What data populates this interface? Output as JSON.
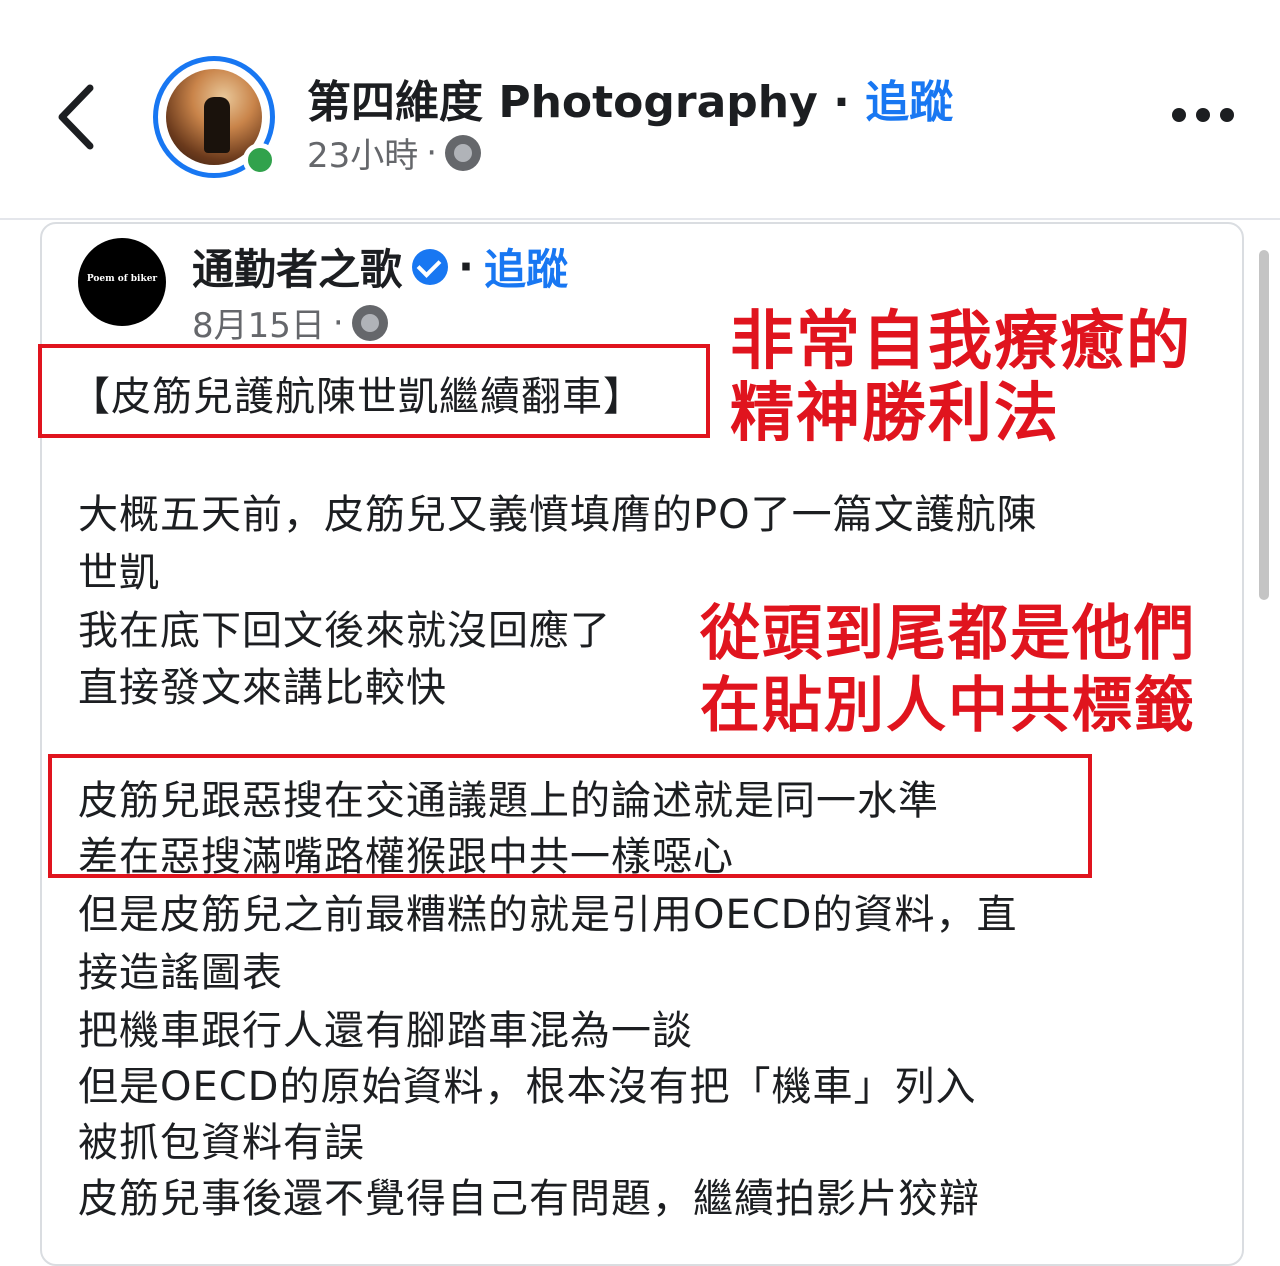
{
  "header": {
    "page_name": "第四維度 Photography",
    "separator": "·",
    "follow_label": "追蹤",
    "time": "23小時",
    "meta_separator": "·",
    "privacy_icon": "globe-icon",
    "back_icon": "chevron-left-icon",
    "more_icon": "more-dots-icon"
  },
  "shared_post": {
    "author": "通勤者之歌",
    "avatar_text": "Poem of biker",
    "verified_icon": "verified-badge-icon",
    "separator": "·",
    "follow_label": "追蹤",
    "date": "8月15日",
    "meta_separator": "·",
    "privacy_icon": "globe-icon",
    "title": "【皮筋兒護航陳世凱繼續翻車】",
    "lines": [
      "大概五天前，皮筋兒又義憤填膺的PO了一篇文護航陳",
      "世凱",
      "我在底下回文後來就沒回應了",
      "直接發文來講比較快",
      "皮筋兒跟惡搜在交通議題上的論述就是同一水準",
      "差在惡搜滿嘴路權猴跟中共一樣噁心",
      "但是皮筋兒之前最糟糕的就是引用OECD的資料，直",
      "接造謠圖表",
      "把機車跟行人還有腳踏車混為一談",
      "但是OECD的原始資料，根本沒有把「機車」列入",
      "被抓包資料有誤",
      "皮筋兒事後還不覺得自己有問題，繼續拍影片狡辯"
    ]
  },
  "annotations": {
    "first": [
      "非常自我療癒的",
      "精神勝利法"
    ],
    "second": [
      "從頭到尾都是他們",
      "在貼別人中共標籤"
    ]
  },
  "colors": {
    "accent_blue": "#1877f2",
    "annotation_red": "#e0141e",
    "online_green": "#31a24c",
    "meta_gray": "#65676b"
  }
}
